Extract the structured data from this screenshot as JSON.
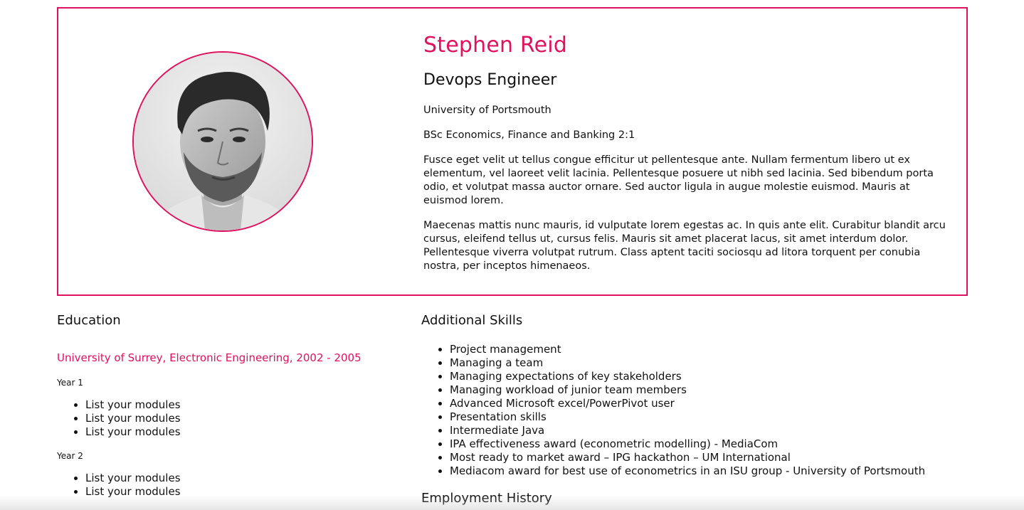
{
  "profile": {
    "name": "Stephen Reid",
    "job_title": "Devops Engineer",
    "university": "University of Portsmouth",
    "degree": "BSc Economics, Finance and Banking 2:1",
    "bio": [
      "Fusce eget velit ut tellus congue efficitur ut pellentesque ante. Nullam fermentum libero ut ex elementum, vel laoreet velit lacinia. Pellentesque posuere ut nibh sed lacinia. Sed bibendum porta odio, et volutpat massa auctor ornare. Sed auctor ligula in augue molestie euismod. Mauris at euismod lorem.",
      "Maecenas mattis nunc mauris, id vulputate lorem egestas ac. In quis ante elit. Curabitur blandit arcu cursus, eleifend tellus ut, cursus felis. Mauris sit amet placerat lacus, sit amet interdum dolor. Pellentesque viverra volutpat rutrum. Class aptent taciti sociosqu ad litora torquent per conubia nostra, per inceptos himenaeos."
    ]
  },
  "education": {
    "heading": "Education",
    "entry": "University of Surrey, Electronic Engineering, 2002 - 2005",
    "years": [
      {
        "label": "Year 1",
        "modules": [
          "List your modules",
          "List your modules",
          "List your modules"
        ]
      },
      {
        "label": "Year 2",
        "modules": [
          "List your modules",
          "List your modules"
        ]
      }
    ]
  },
  "skills": {
    "heading": "Additional Skills",
    "items": [
      "Project management",
      "Managing a team",
      "Managing expectations of key stakeholders",
      "Managing workload of junior team members",
      "Advanced Microsoft excel/PowerPivot user",
      "Presentation skills",
      "Intermediate Java",
      "IPA effectiveness award (econometric modelling) - MediaCom",
      "Most ready to market award – IPG hackathon – UM International",
      "Mediacom award for best use of econometrics in an ISU group - University of Portsmouth"
    ]
  },
  "employment": {
    "heading": "Employment History"
  },
  "colors": {
    "accent": "#e0115f",
    "text": "#111111",
    "background": "#ffffff"
  },
  "icons": {
    "avatar": "profile-photo"
  }
}
